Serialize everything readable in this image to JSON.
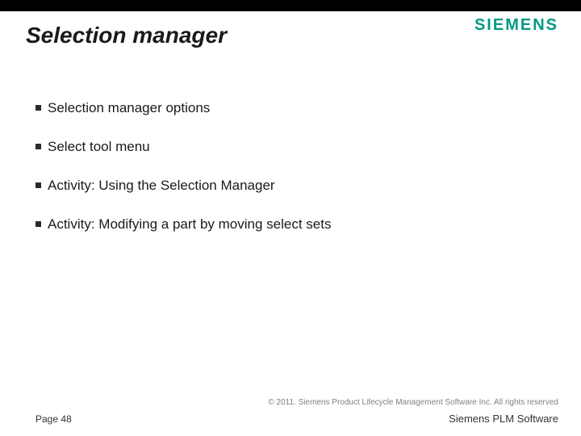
{
  "header": {
    "title": "Selection manager",
    "brand": "SIEMENS"
  },
  "bullets": [
    "Selection manager options",
    "Select tool menu",
    "Activity: Using the Selection Manager",
    "Activity: Modifying a part by moving select sets"
  ],
  "footer": {
    "copyright": "© 2011. Siemens Product Lifecycle Management Software Inc. All rights reserved",
    "page": "Page 48",
    "product": "Siemens PLM Software"
  }
}
